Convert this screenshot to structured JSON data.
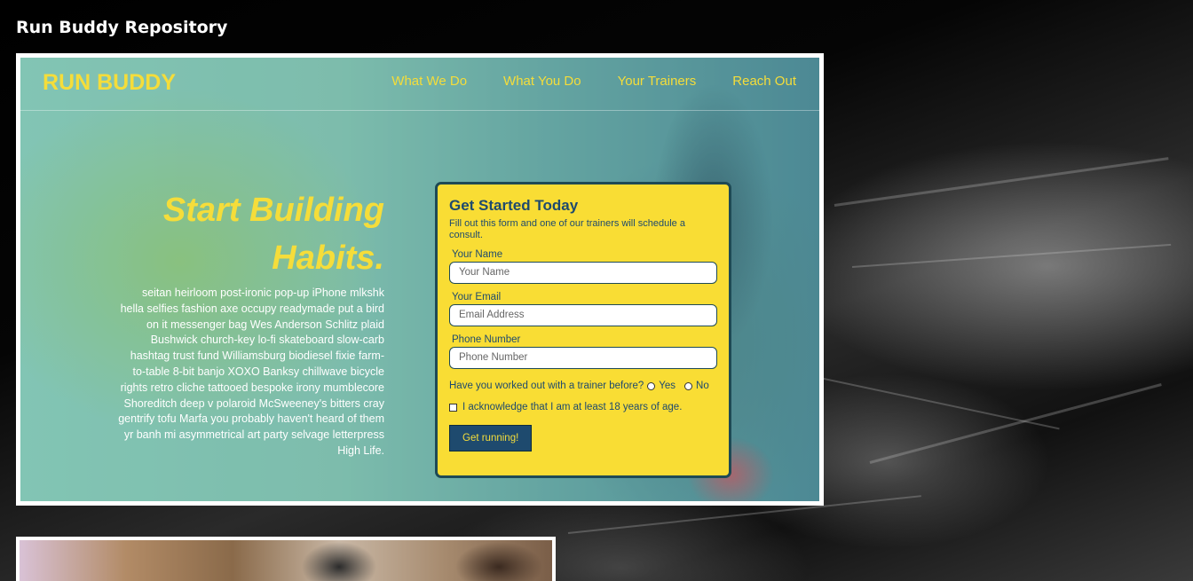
{
  "page": {
    "title": "Run Buddy Repository"
  },
  "preview": {
    "logo": "RUN BUDDY",
    "nav": [
      "What We Do",
      "What You Do",
      "Your Trainers",
      "Reach Out"
    ],
    "hero": {
      "heading_line1": "Start Building",
      "heading_line2": "Habits.",
      "body": "seitan heirloom post-ironic pop-up iPhone mlkshk hella selfies fashion axe occupy readymade put a bird on it messenger bag Wes Anderson Schlitz plaid Bushwick church-key lo-fi skateboard slow-carb hashtag trust fund Williamsburg biodiesel fixie farm-to-table 8-bit banjo XOXO Banksy chillwave bicycle rights retro cliche tattooed bespoke irony mumblecore Shoreditch deep v polaroid McSweeney's bitters cray gentrify tofu Marfa you probably haven't heard of them yr banh mi asymmetrical art party selvage letterpress High Life."
    },
    "form": {
      "title": "Get Started Today",
      "subtitle": "Fill out this form and one of our trainers will schedule a consult.",
      "name_label": "Your Name",
      "name_placeholder": "Your Name",
      "email_label": "Your Email",
      "email_placeholder": "Email Address",
      "phone_label": "Phone Number",
      "phone_placeholder": "Phone Number",
      "question": "Have you worked out with a trainer before?",
      "yes": "Yes",
      "no": "No",
      "acknowledge": "I acknowledge that I am at least 18 years of age.",
      "submit": "Get running!"
    }
  },
  "colors": {
    "accent_yellow": "#f5dd3a",
    "form_bg": "#f9dd34",
    "navy": "#1e4a6e"
  }
}
